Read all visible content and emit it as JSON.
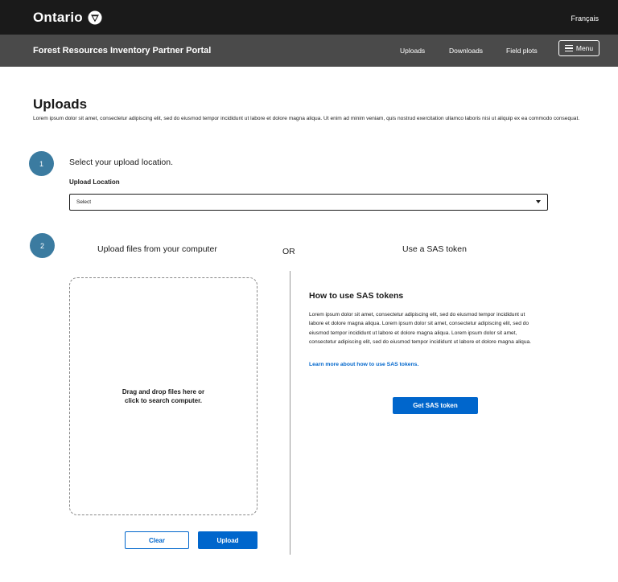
{
  "header": {
    "logo_text": "Ontario",
    "language_link": "Français",
    "portal_title": "Forest Resources Inventory Partner Portal",
    "nav": [
      "Uploads",
      "Downloads",
      "Field plots"
    ],
    "menu_label": "Menu"
  },
  "page": {
    "title": "Uploads",
    "intro": "Lorem ipsum dolor sit amet, consectetur adipiscing elit, sed do eiusmod tempor incididunt ut labore et dolore magna aliqua. Ut enim ad minim veniam, quis nostrud exercitation ullamco laboris nisi ut aliquip ex ea commodo consequat."
  },
  "step1": {
    "number": "1",
    "label": "Select your upload location.",
    "field_label": "Upload Location",
    "select_value": "Select"
  },
  "step2": {
    "number": "2",
    "upload_heading": "Upload files from your computer",
    "or_text": "OR",
    "sas_heading": "Use a SAS token",
    "dropzone_text": "Drag and drop files here or click to search computer.",
    "clear_label": "Clear",
    "upload_label": "Upload"
  },
  "sas": {
    "title": "How to use SAS tokens",
    "body": "Lorem ipsum dolor sit amet, consectetur adipiscing elit, sed do eiusmod tempor incididunt ut labore et dolore magna aliqua. Lorem ipsum dolor sit amet, consectetur adipiscing elit, sed do eiusmod tempor incididunt ut labore et dolore magna aliqua. Lorem ipsum dolor sit amet, consectetur adipiscing elit, sed do eiusmod tempor incididunt ut labore et dolore magna aliqua.",
    "link": "Learn more about how to use SAS tokens.",
    "button": "Get SAS token"
  },
  "colors": {
    "header_bg": "#1a1a1a",
    "subheader_bg": "#4a4a4a",
    "step_circle": "#3b7ba0",
    "primary": "#0066cc"
  },
  "icons": {
    "logo": "ontario-trillium-icon",
    "menu": "hamburger-icon",
    "select": "chevron-down-icon"
  }
}
